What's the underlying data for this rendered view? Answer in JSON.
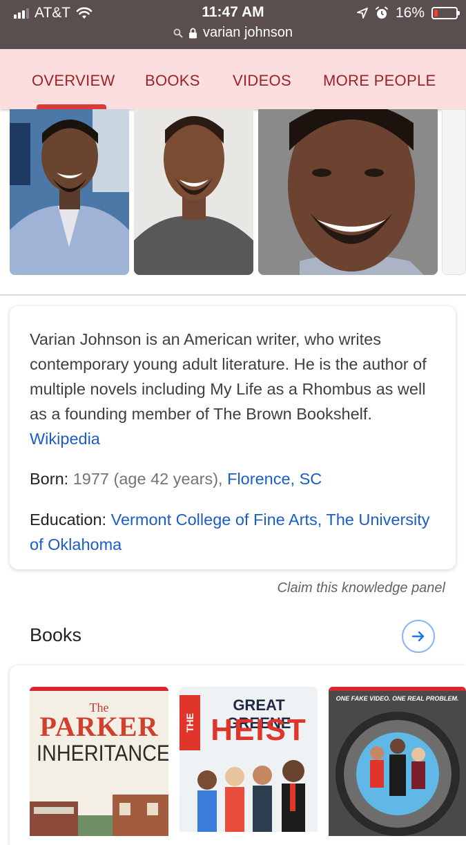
{
  "status_bar": {
    "carrier": "AT&T",
    "time": "11:47 AM",
    "battery_percent": "16%",
    "battery_level": 0.16,
    "url": "varian johnson"
  },
  "tabs": [
    {
      "label": "OVERVIEW",
      "active": true
    },
    {
      "label": "BOOKS",
      "active": false
    },
    {
      "label": "VIDEOS",
      "active": false
    },
    {
      "label": "MORE PEOPLE",
      "active": false
    }
  ],
  "description": {
    "text": "Varian Johnson is an American writer, who writes contemporary young adult literature. He is the author of multiple novels including My Life as a Rhombus as well as a founding member of The Brown Bookshelf.",
    "source_link": "Wikipedia"
  },
  "facts": {
    "born_label": "Born:",
    "born_value": "1977 (age 42 years),",
    "born_place": "Florence, SC",
    "education_label": "Education:",
    "education_value_1": "Vermont College of Fine Arts,",
    "education_value_2": "The University of Oklahoma"
  },
  "claim_link": "Claim this knowledge panel",
  "books_section": {
    "title": "Books",
    "books": [
      {
        "cover_title_1": "The",
        "cover_title_2": "PARKER",
        "cover_title_3": "INHERITANCE"
      },
      {
        "cover_title_1": "THE",
        "cover_title_2": "GREAT GREENE",
        "cover_title_3": "HEIST"
      },
      {
        "cover_tagline": "ONE FAKE VIDEO. ONE REAL PROBLEM."
      }
    ]
  },
  "colors": {
    "accent_red": "#d93a3a",
    "tab_text": "#9b2226",
    "link_blue": "#1a5dc6",
    "tab_bar_bg": "#fcdede"
  },
  "icons": [
    "signal-icon",
    "wifi-icon",
    "location-icon",
    "alarm-icon",
    "battery-icon",
    "search-icon",
    "lock-icon",
    "arrow-right-icon"
  ]
}
